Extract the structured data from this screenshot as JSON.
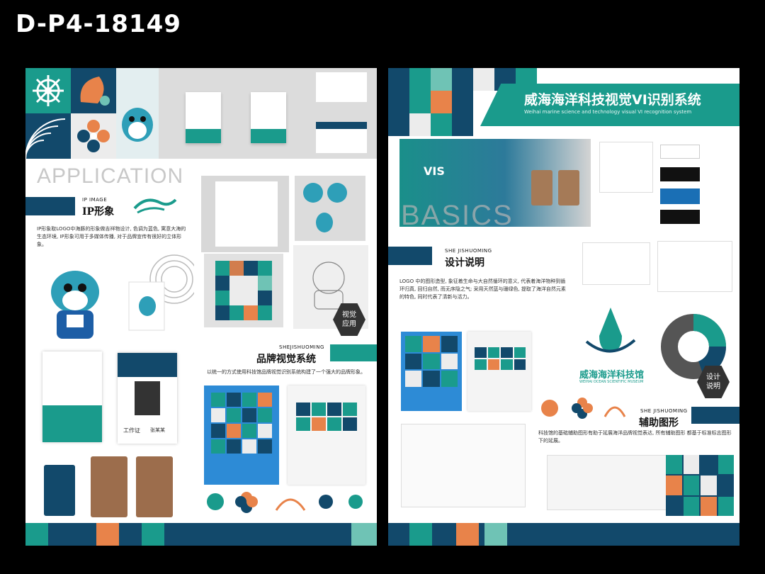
{
  "code": "D-P4-18149",
  "left_board": {
    "application_title": "APPLICATION",
    "ip_image_en": "IP IMAGE",
    "ip_image_cn": "IP形象",
    "ip_desc": "IP形象取LOGO中海豚的形象做吉祥物设计, 色调为蓝色, 寓意大海的生态环境, IP形象可用于多媒体传播, 对于品牌宣传有很好的立体形象。",
    "badge": "视觉\n应用",
    "system_en": "SHEJISHUOMING",
    "system_cn": "品牌视觉系统",
    "system_desc": "以统一的方式使用科技馆品牌视觉识别系统构建了一个强大的品牌形象。",
    "id_card_role": "工作证",
    "id_card_name": "张某某"
  },
  "right_board": {
    "main_title": "威海海洋科技视觉VI识别系统",
    "subtitle": "Weihai marine science and technology visual VI recognition system",
    "vis": "VIS",
    "basics": "BASICS",
    "design_en": "SHE JISHUOMING",
    "design_cn": "设计说明",
    "design_desc": "LOGO 中的图形造型, 象征着生命与大自然循环的意义, 代表着海洋物种到循环归真, 回归自然, 而无序隐之气; 采用天然蓝与珊绿色, 提取了海洋自然元素的特色, 同时代表了清新与活力。",
    "logo_cn": "威海海洋科技馆",
    "logo_en": "WEIHAI OCEAN SCIENTIFIC MUSEUM",
    "badge": "设计\n说明",
    "aux_en": "SHE JISHUOMING",
    "aux_cn": "辅助图形",
    "aux_desc": "科技馆的基础辅助图形有助于延展海洋品牌视觉表达, 所有辅助图形 都基于标准标志图形下的延展。"
  },
  "colors": {
    "teal": "#1a9b8c",
    "navy": "#12496b",
    "light_teal": "#6fc3b5",
    "orange": "#e8834a"
  }
}
